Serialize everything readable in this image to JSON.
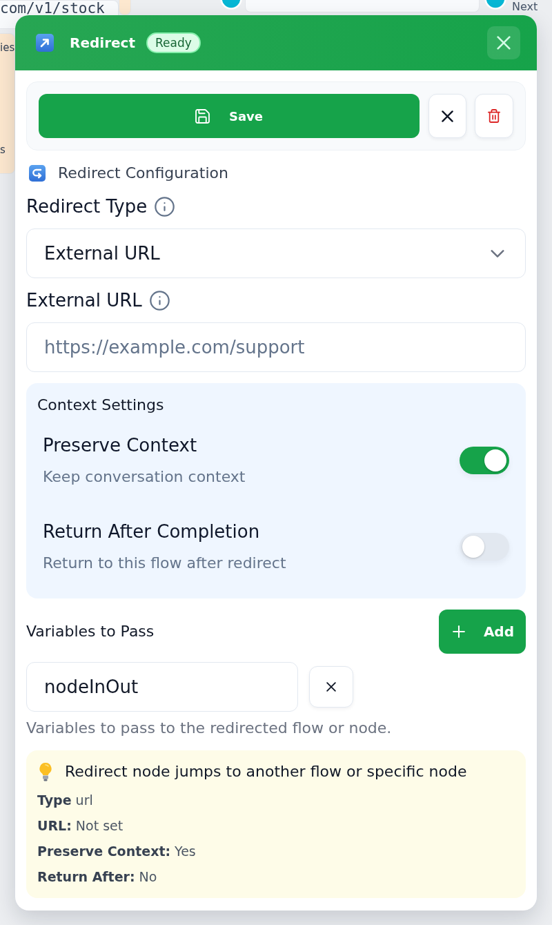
{
  "canvas": {
    "nodes": [
      {
        "kind": "code",
        "color": "#f8fafc",
        "lines": [
          "com/v1/stock"
        ]
      },
      {
        "kind": "note",
        "color": "#fde8cf",
        "lines": [
          "ies",
          "s"
        ]
      }
    ],
    "edge_label": "Next"
  },
  "header": {
    "title": "Redirect",
    "status": "Ready"
  },
  "toolbar": {
    "save_label": "Save"
  },
  "section_title": "Redirect Configuration",
  "redirect_type": {
    "label": "Redirect Type",
    "value": "External URL"
  },
  "external_url": {
    "label": "External URL",
    "placeholder": "https://example.com/support"
  },
  "context_settings": {
    "title": "Context Settings",
    "rows": [
      {
        "title": "Preserve Context",
        "description": "Keep conversation context",
        "on": true
      },
      {
        "title": "Return After Completion",
        "description": "Return to this flow after redirect",
        "on": false
      }
    ]
  },
  "variables": {
    "title": "Variables to Pass",
    "add_label": "Add",
    "items": [
      {
        "value": "nodeInOut"
      }
    ],
    "help": "Variables to pass to the redirected flow or node."
  },
  "summary": {
    "title": "Redirect node jumps to another flow or specific node",
    "lines": [
      "**Type** url",
      "**URL:** Not set",
      "**Preserve Context:** Yes",
      "**Return After:** No"
    ]
  }
}
